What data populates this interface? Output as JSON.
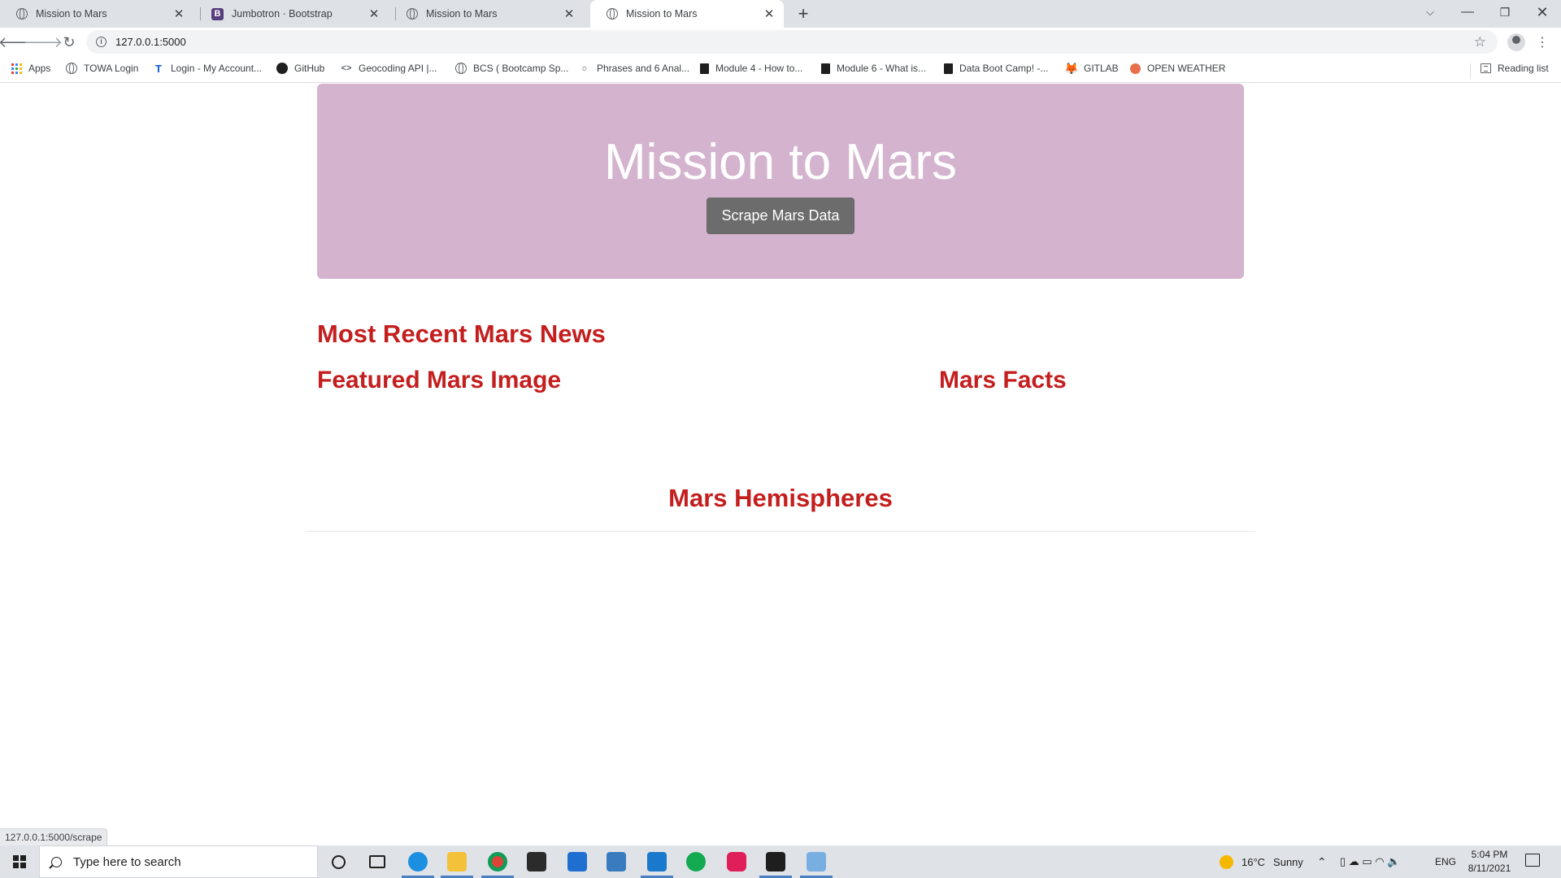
{
  "browser": {
    "tabs": [
      {
        "title": "Mission to Mars",
        "favicon": "globe-icon",
        "active": false
      },
      {
        "title": "Jumbotron · Bootstrap",
        "favicon": "bootstrap-icon",
        "active": false
      },
      {
        "title": "Mission to Mars",
        "favicon": "globe-icon",
        "active": false
      },
      {
        "title": "Mission to Mars",
        "favicon": "globe-icon",
        "active": true
      }
    ],
    "bootstrap_glyph": "B",
    "url": "127.0.0.1:5000",
    "bookmarks": [
      {
        "label": "Apps",
        "icon": "apps-grid-icon"
      },
      {
        "label": "TOWA Login",
        "icon": "globe-icon"
      },
      {
        "label": "Login - My Account...",
        "icon": "telstra-icon"
      },
      {
        "label": "GitHub",
        "icon": "github-icon"
      },
      {
        "label": "Geocoding API |...",
        "icon": "code-icon"
      },
      {
        "label": "BCS ( Bootcamp Sp...",
        "icon": "globe-icon"
      },
      {
        "label": "Phrases and 6 Anal...",
        "icon": "phrases-icon"
      },
      {
        "label": "Module 4 - How to...",
        "icon": "book-icon"
      },
      {
        "label": "Module 6 - What is...",
        "icon": "book-icon"
      },
      {
        "label": "Data Boot Camp! -...",
        "icon": "book-icon"
      },
      {
        "label": "GITLAB",
        "icon": "gitlab-icon"
      },
      {
        "label": "OPEN WEATHER",
        "icon": "openweather-icon"
      }
    ],
    "reading_list": "Reading list",
    "status_url": "127.0.0.1:5000/scrape"
  },
  "page": {
    "jumbotron_title": "Mission to Mars",
    "scrape_button": "Scrape Mars Data",
    "news_heading": "Most Recent Mars News",
    "featured_heading": "Featured Mars Image",
    "facts_heading": "Mars Facts",
    "hemispheres_heading": "Mars Hemispheres"
  },
  "taskbar": {
    "search_placeholder": "Type here to search",
    "pinned": [
      "cortana-icon",
      "task-view-icon",
      "edge-icon",
      "file-explorer-icon",
      "chrome-icon",
      "store-icon",
      "mail-icon",
      "python-icon",
      "vscode-icon",
      "mongodb-icon",
      "slack-icon",
      "terminal-icon",
      "notepad-icon"
    ],
    "weather": {
      "temp": "16°C",
      "condition": "Sunny"
    },
    "language": "ENG",
    "time": "5:04 PM",
    "date": "8/11/2021"
  },
  "colors": {
    "jumbotron_bg": "#d4b3cf",
    "heading_red": "#c41e1e",
    "button_bg": "#6c6c6c"
  }
}
